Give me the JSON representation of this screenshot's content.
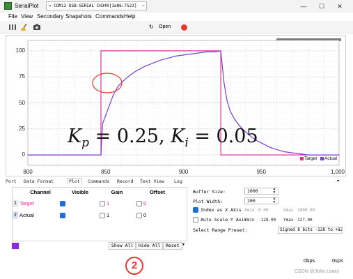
{
  "window": {
    "title": "SerialPlot",
    "minimize_glyph": "—",
    "maximize_glyph": "☐",
    "close_glyph": "✕"
  },
  "menu": [
    "File",
    "View",
    "Secondary",
    "Snapshots",
    "Commands",
    "Help"
  ],
  "toolbar": {
    "port_value": "↪ COM12 USB-SERIAL CH340[1a86:7523]",
    "combo_arrow": "⌄",
    "refresh_glyph": "↻",
    "open_label": "Open",
    "icons": [
      "bars-icon",
      "broom-icon",
      "camera-icon",
      "record-icon"
    ]
  },
  "plot": {
    "annotation": {
      "k_p": "K",
      "p_sub": "p",
      "eq1": " = 0.25, ",
      "k_i": "K",
      "i_sub": "i",
      "eq2": " = 0.05"
    },
    "colors": {
      "target": "#e0309a",
      "actual": "#7b3fd6",
      "annotation_circle": "#e53935"
    }
  },
  "chart_data": {
    "type": "line",
    "title": "",
    "xlabel": "",
    "ylabel": "",
    "xlim": [
      800,
      1000
    ],
    "ylim": [
      -10,
      110
    ],
    "x_ticks": [
      800,
      850,
      900,
      950,
      1000
    ],
    "x_tick_labels": [
      "800",
      "850",
      "900",
      "950",
      "1,000"
    ],
    "y_ticks": [
      0,
      25,
      50,
      75,
      100
    ],
    "y_tick_labels": [
      "0",
      "25",
      "50",
      "75",
      "100"
    ],
    "grid": true,
    "legend": "bottom-right",
    "series": [
      {
        "name": "Target",
        "color": "#e0309a",
        "x": [
          800,
          847,
          847,
          924,
          924,
          1000
        ],
        "y": [
          0,
          0,
          100,
          100,
          0,
          0
        ]
      },
      {
        "name": "Actual",
        "color": "#7b3fd6",
        "x": [
          800,
          847,
          848,
          850,
          852,
          855,
          858,
          862,
          866,
          870,
          875,
          880,
          885,
          890,
          895,
          900,
          905,
          910,
          915,
          920,
          924,
          925,
          926,
          928,
          930,
          933,
          936,
          940,
          944,
          948,
          952,
          956,
          960,
          965,
          970,
          975,
          980,
          985,
          990,
          1000
        ],
        "y": [
          0,
          0,
          30,
          38,
          46,
          58,
          66,
          72,
          77,
          81,
          85,
          88,
          91,
          93,
          95,
          96,
          97,
          98,
          99,
          99,
          100,
          85,
          70,
          52,
          42,
          34,
          28,
          22,
          17,
          13,
          10,
          7,
          5,
          3,
          2,
          1,
          0,
          0,
          0,
          0
        ]
      }
    ]
  },
  "tabs": [
    "Port",
    "Data Format",
    "Plot",
    "Commands",
    "Record",
    "Text View",
    "Log"
  ],
  "active_tab": "Plot",
  "tab_chevron": "▾",
  "channel_table": {
    "headers": [
      "Channel",
      "Visible",
      "Gain",
      "Offset"
    ],
    "rows": [
      {
        "index": "1",
        "name": "Target",
        "name_color": "#e0309a",
        "visible": true,
        "gain": "1",
        "offset": "0"
      },
      {
        "index": "2",
        "name": "Actual",
        "name_color": "#000000",
        "visible": true,
        "gain": "1",
        "offset": "0"
      }
    ]
  },
  "table_buttons": {
    "show_all": "Show All",
    "hide_all": "Hide All",
    "reset": "Reset",
    "reset_arrow": "▾"
  },
  "plot_settings": {
    "buffer_size_label": "Buffer Size:",
    "buffer_size_value": "1000",
    "plot_width_label": "Plot Width:",
    "plot_width_value": "200",
    "index_as_x_label": "Index as X AXis",
    "index_as_x_checked": true,
    "xmin_label": "Xmin",
    "xmin_value": "0.00",
    "xmax_label": "Xmax",
    "xmax_value": "1000.00",
    "auto_scale_label": "Auto Scale Y Axis",
    "auto_scale_checked": false,
    "ymin_label": "Ymin",
    "ymin_value": "-128.00",
    "ymax_label": "Ymax",
    "ymax_value": "127.00",
    "range_preset_label": "Select Range Preset:",
    "range_preset_value": "Signed 8 bits -128 to +127",
    "spin_up": "▲",
    "spin_down": "▼",
    "combo_arrow": "⌄"
  },
  "status": {
    "left": "0bps",
    "right": "0sps",
    "callout_number": "2"
  },
  "watermark": "CSDN @John.Lewis"
}
